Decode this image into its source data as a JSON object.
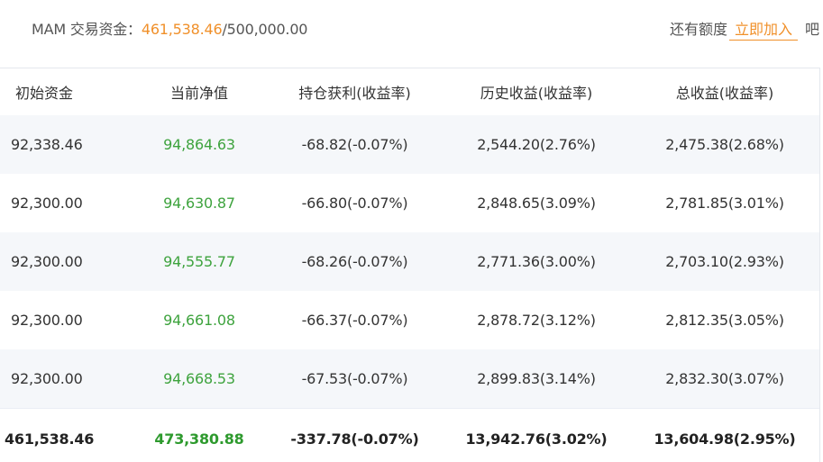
{
  "header": {
    "funds_label": "MAM 交易资金：",
    "funds_used": "461,538.46",
    "funds_separator": "/",
    "funds_total": "500,000.00",
    "quota_text": "还有额度",
    "join_link": "立即加入",
    "quota_suffix": "吧"
  },
  "table": {
    "columns": [
      "初始资金",
      "当前净值",
      "持仓获利(收益率)",
      "历史收益(收益率)",
      "总收益(收益率)"
    ],
    "rows": [
      [
        "92,338.46",
        "94,864.63",
        "-68.82(-0.07%)",
        "2,544.20(2.76%)",
        "2,475.38(2.68%)"
      ],
      [
        "92,300.00",
        "94,630.87",
        "-66.80(-0.07%)",
        "2,848.65(3.09%)",
        "2,781.85(3.01%)"
      ],
      [
        "92,300.00",
        "94,555.77",
        "-68.26(-0.07%)",
        "2,771.36(3.00%)",
        "2,703.10(2.93%)"
      ],
      [
        "92,300.00",
        "94,661.08",
        "-66.37(-0.07%)",
        "2,878.72(3.12%)",
        "2,812.35(3.05%)"
      ],
      [
        "92,300.00",
        "94,668.53",
        "-67.53(-0.07%)",
        "2,899.83(3.14%)",
        "2,832.30(3.07%)"
      ]
    ],
    "total": [
      "461,538.46",
      "473,380.88",
      "-337.78(-0.07%)",
      "13,942.76(3.02%)",
      "13,604.98(2.95%)"
    ]
  },
  "colors": {
    "accent": "#f0902a",
    "net_value_green": "#3ea33e",
    "row_stripe": "#f5f7fa"
  }
}
